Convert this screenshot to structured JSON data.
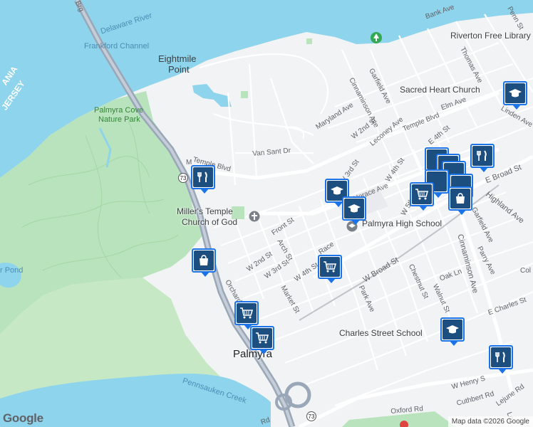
{
  "labels": {
    "water": [
      "Delaware River",
      "Frankford Channel",
      "Pennsauken Creek",
      "r Pond"
    ],
    "region": [
      "ANIA",
      "JERSEY"
    ],
    "parks": [
      "Palmyra Cove",
      "Nature Park"
    ],
    "places": [
      "Eightmile",
      "Point",
      "Palmyra"
    ],
    "pois": [
      "Miller's Temple",
      "Church of God",
      "Palmyra High School",
      "Sacred Heart Church",
      "Riverton Free Library",
      "Charles Street School"
    ],
    "streets": [
      "Bank Ave",
      "Penn St",
      "Thomas Ave",
      "Garfield Ave",
      "Cinnaminson Ave",
      "Elm Ave",
      "Linden Ave",
      "Temple Blvd",
      "Maryland Ave",
      "W 2nd St",
      "Leconey Ave",
      "E 4th St",
      "Van Sant Dr",
      "W 3rd St",
      "W 4th St",
      "E Broad St",
      "Highland Ave",
      "Horace Ave",
      "W 5th",
      "Front St",
      "Arch St",
      "W 2nd St",
      "W 3rd St",
      "W 4th St",
      "Race",
      "W Broad St",
      "Garfield Ave",
      "Parry Ave",
      "Cinnaminson Ave",
      "Chestnut St",
      "Oak Ln",
      "Park Ave",
      "Walnut St",
      "E Charles St",
      "Orchard",
      "Market St",
      "W Henry S",
      "Cuthbert Rd",
      "Lejune Rd",
      "Oxford Rd",
      "Temple Blvd",
      "Rd",
      "Brg",
      "Col",
      "M",
      "Lo"
    ],
    "routes": [
      "73",
      "73"
    ]
  },
  "markers": [
    {
      "type": "restaurant",
      "icon": "fork-knife-icon"
    },
    {
      "type": "shopping",
      "icon": "shopping-bag-icon"
    },
    {
      "type": "grocery",
      "icon": "shopping-cart-icon"
    },
    {
      "type": "grocery",
      "icon": "shopping-cart-icon"
    },
    {
      "type": "grocery",
      "icon": "shopping-cart-icon"
    },
    {
      "type": "school",
      "icon": "graduation-cap-icon"
    },
    {
      "type": "school",
      "icon": "graduation-cap-icon"
    },
    {
      "type": "school",
      "icon": "graduation-cap-icon"
    },
    {
      "type": "school",
      "icon": "graduation-cap-icon"
    },
    {
      "type": "grocery",
      "icon": "shopping-cart-icon"
    },
    {
      "type": "shopping",
      "icon": "shopping-bag-icon"
    },
    {
      "type": "restaurant",
      "icon": "fork-knife-icon"
    }
  ],
  "attribution": "Map data ©2026 Google",
  "logo": "Google",
  "colors": {
    "water": "#8ed4ec",
    "park": "#b9e3bc",
    "land": "#f1f3f4",
    "road": "#ffffff",
    "highway": "#9aa7b8",
    "marker": "#1c4e80",
    "markerBorder": "#1a73e8"
  }
}
